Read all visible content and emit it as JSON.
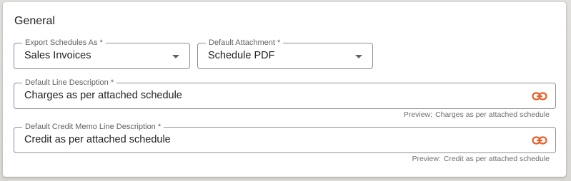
{
  "section": {
    "title": "General"
  },
  "export_schedules_as": {
    "label": "Export Schedules As *",
    "value": "Sales Invoices"
  },
  "default_attachment": {
    "label": "Default Attachment *",
    "value": "Schedule PDF"
  },
  "default_line_description": {
    "label": "Default Line Description *",
    "value": "Charges as per attached schedule",
    "preview_label": "Preview:",
    "preview_value": "Charges as per attached schedule"
  },
  "default_credit_memo_line_description": {
    "label": "Default Credit Memo Line Description *",
    "value": "Credit as per attached schedule",
    "preview_label": "Preview:",
    "preview_value": "Credit as per attached schedule"
  },
  "colors": {
    "accent_link_icon": "#e6602a",
    "border": "#8f8f8f"
  },
  "icons": {
    "dropdown": "chevron-down-icon",
    "merge_field": "link-icon"
  }
}
